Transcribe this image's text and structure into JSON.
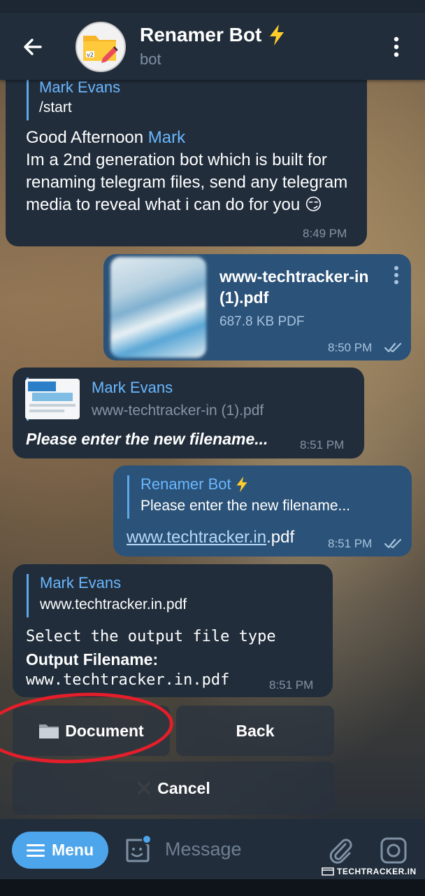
{
  "header": {
    "title": "Renamer Bot",
    "subtitle": "bot",
    "title_icon": "lightning-bolt-icon"
  },
  "messages": [
    {
      "quote_name": "Mark Evans",
      "quote_text": "/start",
      "greeting": "Good Afternoon ",
      "greeting_name": "Mark",
      "body": "Im a 2nd generation bot which is built for renaming telegram files, send any telegram media to reveal what i can do for you",
      "emoji": "😏",
      "time": "8:49 PM"
    },
    {
      "file_name": "www-techtracker-in (1).pdf",
      "file_size": "687.8 KB PDF",
      "time": "8:50 PM"
    },
    {
      "quote_name": "Mark Evans",
      "quote_text": "www-techtracker-in (1).pdf",
      "body": "Please enter the new filename...",
      "time": "8:51 PM"
    },
    {
      "quote_name": "Renamer Bot",
      "quote_text": "Please enter the new filename...",
      "link": "www.techtracker.in",
      "ext": ".pdf",
      "time": "8:51 PM"
    },
    {
      "quote_name": "Mark Evans",
      "quote_text": "www.techtracker.in.pdf",
      "line1": "Select the output file type",
      "line2": "Output Filename:",
      "line3": "www.techtracker.in.pdf",
      "time": "8:51 PM"
    }
  ],
  "keyboard": {
    "document": "Document",
    "back": "Back",
    "cancel": "Cancel"
  },
  "input": {
    "menu": "Menu",
    "placeholder": "Message"
  },
  "watermark": "TECHTRACKER.IN",
  "colors": {
    "incoming": "#212d3b",
    "outgoing": "#2b5278",
    "accent": "#4da5ec",
    "link": "#6ab7ff",
    "annotation": "#e41e2a"
  }
}
